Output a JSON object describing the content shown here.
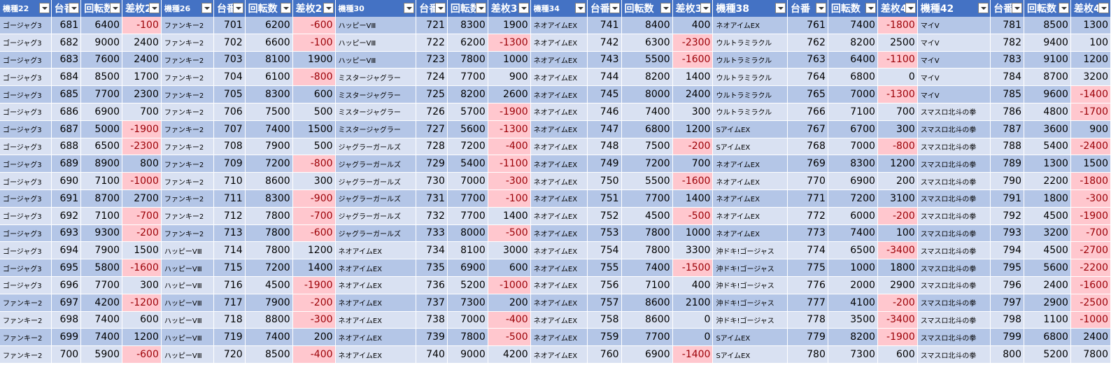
{
  "colors": {
    "header_bg": "#4472c4",
    "band_dark": "#b4c6e7",
    "band_light": "#d9e1f2",
    "neg_bg": "#ffc7ce",
    "neg_text": "#9c0006"
  },
  "headers": [
    "機種22",
    "台番",
    "回転数",
    "差枚2",
    "機種26",
    "台番",
    "回転数",
    "差枚2",
    "機種30",
    "台番",
    "回転数",
    "差枚3",
    "機種34",
    "台番",
    "回転数",
    "差枚3",
    "機種38",
    "台番",
    "回転数",
    "差枚4",
    "機種42",
    "台番",
    "回転数",
    "差枚4"
  ],
  "rows": [
    [
      "ゴージャグ3",
      "681",
      "6400",
      "-100",
      "ファンキー2",
      "701",
      "6200",
      "-600",
      "ハッピーVⅢ",
      "721",
      "8300",
      "1900",
      "ネオアイムEX",
      "741",
      "8400",
      "400",
      "ネオアイムEX",
      "761",
      "7400",
      "-1800",
      "マイV",
      "781",
      "8500",
      "1300"
    ],
    [
      "ゴージャグ3",
      "682",
      "9000",
      "2400",
      "ファンキー2",
      "702",
      "6600",
      "-100",
      "ハッピーVⅢ",
      "722",
      "6200",
      "-1300",
      "ネオアイムEX",
      "742",
      "6300",
      "-2300",
      "ウルトラミラクル",
      "762",
      "8200",
      "2500",
      "マイV",
      "782",
      "9400",
      "100"
    ],
    [
      "ゴージャグ3",
      "683",
      "7600",
      "2400",
      "ファンキー2",
      "703",
      "8100",
      "1900",
      "ハッピーVⅢ",
      "723",
      "7800",
      "1000",
      "ネオアイムEX",
      "743",
      "5500",
      "-1600",
      "ウルトラミラクル",
      "763",
      "6400",
      "-1100",
      "マイV",
      "783",
      "9100",
      "1200"
    ],
    [
      "ゴージャグ3",
      "684",
      "8500",
      "1700",
      "ファンキー2",
      "704",
      "6100",
      "-800",
      "ミスタージャグラー",
      "724",
      "7700",
      "900",
      "ネオアイムEX",
      "744",
      "8200",
      "1400",
      "ウルトラミラクル",
      "764",
      "6800",
      "0",
      "マイV",
      "784",
      "8700",
      "3200"
    ],
    [
      "ゴージャグ3",
      "685",
      "7700",
      "2300",
      "ファンキー2",
      "705",
      "8300",
      "600",
      "ミスタージャグラー",
      "725",
      "8200",
      "2600",
      "ネオアイムEX",
      "745",
      "8000",
      "2400",
      "ウルトラミラクル",
      "765",
      "7000",
      "-1300",
      "マイV",
      "785",
      "9600",
      "-1400"
    ],
    [
      "ゴージャグ3",
      "686",
      "6900",
      "700",
      "ファンキー2",
      "706",
      "7500",
      "500",
      "ミスタージャグラー",
      "726",
      "5700",
      "-1900",
      "ネオアイムEX",
      "746",
      "7400",
      "300",
      "ウルトラミラクル",
      "766",
      "7100",
      "700",
      "スマスロ北斗の拳",
      "786",
      "4800",
      "-1700"
    ],
    [
      "ゴージャグ3",
      "687",
      "5000",
      "-1900",
      "ファンキー2",
      "707",
      "7400",
      "1500",
      "ミスタージャグラー",
      "727",
      "5600",
      "-1300",
      "ネオアイムEX",
      "747",
      "6800",
      "1200",
      "SアイムEX",
      "767",
      "6700",
      "300",
      "スマスロ北斗の拳",
      "787",
      "3600",
      "900"
    ],
    [
      "ゴージャグ3",
      "688",
      "6500",
      "-2300",
      "ファンキー2",
      "708",
      "7900",
      "500",
      "ジャグラーガールズ",
      "728",
      "7200",
      "-400",
      "ネオアイムEX",
      "748",
      "7500",
      "-200",
      "SアイムEX",
      "768",
      "7000",
      "-800",
      "スマスロ北斗の拳",
      "788",
      "5400",
      "-2400"
    ],
    [
      "ゴージャグ3",
      "689",
      "8900",
      "800",
      "ファンキー2",
      "709",
      "7200",
      "-800",
      "ジャグラーガールズ",
      "729",
      "5400",
      "-1100",
      "ネオアイムEX",
      "749",
      "7200",
      "700",
      "ネオアイムEX",
      "769",
      "8300",
      "1200",
      "スマスロ北斗の拳",
      "789",
      "1300",
      "1500"
    ],
    [
      "ゴージャグ3",
      "690",
      "7100",
      "-1000",
      "ファンキー2",
      "710",
      "8600",
      "300",
      "ジャグラーガールズ",
      "730",
      "7000",
      "-300",
      "ネオアイムEX",
      "750",
      "5500",
      "-1600",
      "ネオアイムEX",
      "770",
      "6900",
      "200",
      "スマスロ北斗の拳",
      "790",
      "2200",
      "-1800"
    ],
    [
      "ゴージャグ3",
      "691",
      "8700",
      "2700",
      "ファンキー2",
      "711",
      "8300",
      "-900",
      "ジャグラーガールズ",
      "731",
      "7700",
      "-100",
      "ネオアイムEX",
      "751",
      "7700",
      "1400",
      "ネオアイムEX",
      "771",
      "7200",
      "3100",
      "スマスロ北斗の拳",
      "791",
      "1800",
      "-300"
    ],
    [
      "ゴージャグ3",
      "692",
      "7100",
      "-700",
      "ファンキー2",
      "712",
      "7800",
      "-700",
      "ジャグラーガールズ",
      "732",
      "7700",
      "1400",
      "ネオアイムEX",
      "752",
      "4500",
      "-500",
      "ネオアイムEX",
      "772",
      "6000",
      "-200",
      "スマスロ北斗の拳",
      "792",
      "4500",
      "-1900"
    ],
    [
      "ゴージャグ3",
      "693",
      "9300",
      "-200",
      "ファンキー2",
      "713",
      "7800",
      "-600",
      "ジャグラーガールズ",
      "733",
      "8000",
      "-500",
      "ネオアイムEX",
      "753",
      "7800",
      "1000",
      "ネオアイムEX",
      "773",
      "7400",
      "100",
      "スマスロ北斗の拳",
      "793",
      "3200",
      "-700"
    ],
    [
      "ゴージャグ3",
      "694",
      "7900",
      "1500",
      "ハッピーVⅢ",
      "714",
      "7800",
      "1200",
      "ネオアイムEX",
      "734",
      "8100",
      "3000",
      "ネオアイムEX",
      "754",
      "7800",
      "3300",
      "沖ドキ!ゴージャス",
      "774",
      "6500",
      "-3400",
      "スマスロ北斗の拳",
      "794",
      "4500",
      "-2700"
    ],
    [
      "ゴージャグ3",
      "695",
      "5800",
      "-1600",
      "ハッピーVⅢ",
      "715",
      "7200",
      "1400",
      "ネオアイムEX",
      "735",
      "6900",
      "600",
      "ネオアイムEX",
      "755",
      "7400",
      "-1500",
      "沖ドキ!ゴージャス",
      "775",
      "1000",
      "1800",
      "スマスロ北斗の拳",
      "795",
      "5600",
      "-2200"
    ],
    [
      "ゴージャグ3",
      "696",
      "7700",
      "300",
      "ハッピーVⅢ",
      "716",
      "4500",
      "-1900",
      "ネオアイムEX",
      "736",
      "5200",
      "-1000",
      "ネオアイムEX",
      "756",
      "7100",
      "400",
      "沖ドキ!ゴージャス",
      "776",
      "2000",
      "2900",
      "スマスロ北斗の拳",
      "796",
      "2400",
      "-1600"
    ],
    [
      "ファンキー2",
      "697",
      "4200",
      "-1200",
      "ハッピーVⅢ",
      "717",
      "7900",
      "-200",
      "ネオアイムEX",
      "737",
      "7300",
      "200",
      "ネオアイムEX",
      "757",
      "8600",
      "2100",
      "沖ドキ!ゴージャス",
      "777",
      "4100",
      "-200",
      "スマスロ北斗の拳",
      "797",
      "2900",
      "-2500"
    ],
    [
      "ファンキー2",
      "698",
      "7400",
      "600",
      "ハッピーVⅢ",
      "718",
      "8800",
      "-300",
      "ネオアイムEX",
      "738",
      "7000",
      "-400",
      "ネオアイムEX",
      "758",
      "8600",
      "0",
      "沖ドキ!ゴージャス",
      "778",
      "3500",
      "-3400",
      "スマスロ北斗の拳",
      "798",
      "1100",
      "-1000"
    ],
    [
      "ファンキー2",
      "699",
      "7400",
      "1200",
      "ハッピーVⅢ",
      "719",
      "7400",
      "200",
      "ネオアイムEX",
      "739",
      "7800",
      "-500",
      "ネオアイムEX",
      "759",
      "7700",
      "0",
      "SアイムEX",
      "779",
      "8200",
      "-1900",
      "スマスロ北斗の拳",
      "799",
      "6800",
      "2400"
    ],
    [
      "ファンキー2",
      "700",
      "5900",
      "-600",
      "ハッピーVⅢ",
      "720",
      "8500",
      "-400",
      "ネオアイムEX",
      "740",
      "9000",
      "4200",
      "ネオアイムEX",
      "760",
      "6900",
      "-1400",
      "SアイムEX",
      "780",
      "7300",
      "600",
      "スマスロ北斗の拳",
      "800",
      "5200",
      "7800"
    ]
  ]
}
